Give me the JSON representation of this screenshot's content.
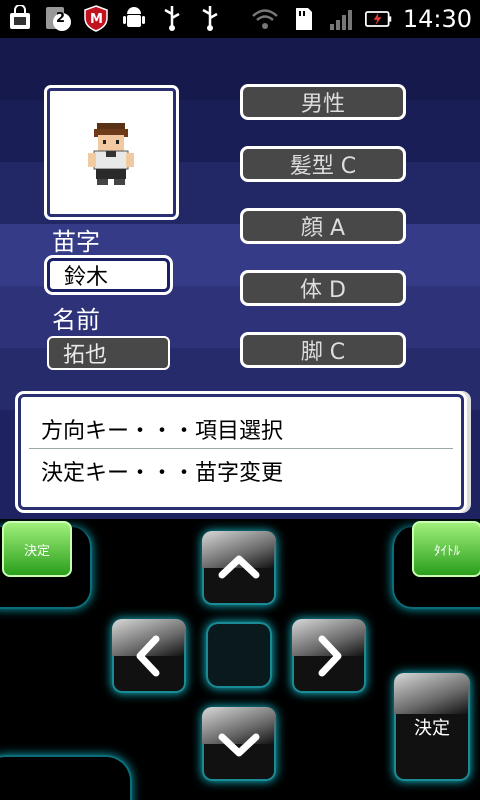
{
  "status_bar": {
    "icons": [
      "shopping-bag-icon",
      "notification-count-icon",
      "mcafee-icon",
      "android-icon",
      "usb-icon",
      "usb-icon",
      "wifi-icon",
      "sd-card-icon",
      "signal-icon",
      "battery-charging-icon"
    ],
    "notification_count": "2",
    "time": "14:30"
  },
  "character": {
    "surname_label": "苗字",
    "surname_value": "鈴木",
    "given_name_label": "名前",
    "given_name_value": "拓也"
  },
  "options": [
    "男性",
    "髪型 C",
    "顔 A",
    "体 D",
    "脚 C"
  ],
  "message": {
    "line1": "方向キー・・・項目選択",
    "line2": "決定キー・・・苗字変更"
  },
  "controller": {
    "decide_small_label": "決定",
    "title_label": "ﾀｲﾄﾙ",
    "decide_big_label": "決定"
  },
  "colors": {
    "accent_glow": "#14c6d8",
    "green_button": "#5cc83a"
  }
}
